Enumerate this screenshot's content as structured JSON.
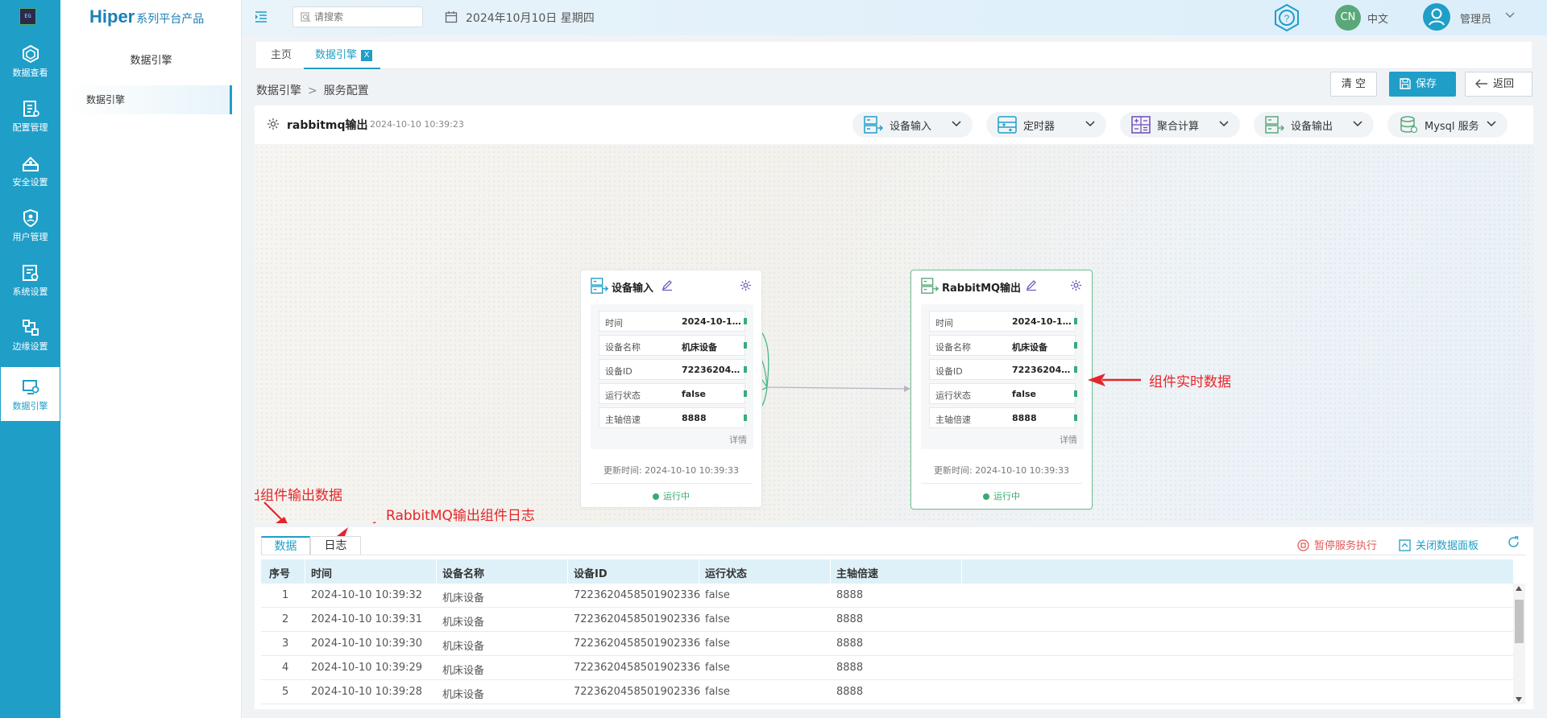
{
  "sidebar": {
    "items": [
      {
        "label": "数据查看",
        "icon": "data-view-icon"
      },
      {
        "label": "配置管理",
        "icon": "config-icon"
      },
      {
        "label": "安全设置",
        "icon": "security-icon"
      },
      {
        "label": "用户管理",
        "icon": "user-manage-icon"
      },
      {
        "label": "系统设置",
        "icon": "system-settings-icon"
      },
      {
        "label": "边缘设置",
        "icon": "edge-settings-icon"
      },
      {
        "label": "数据引擎",
        "icon": "data-engine-icon",
        "active": true
      }
    ],
    "logo_text": "EG"
  },
  "brand": {
    "name": "Hiper",
    "tagline": "系列平台产品"
  },
  "submenu": {
    "title": "数据引擎",
    "items": [
      "数据引擎"
    ]
  },
  "topbar": {
    "search_placeholder": "请搜索",
    "date": "2024年10月10日 星期四",
    "lang_badge": "CN",
    "lang": "中文",
    "user": "管理员"
  },
  "tabs": [
    {
      "label": "主页"
    },
    {
      "label": "数据引擎",
      "active": true,
      "close": "X"
    }
  ],
  "breadcrumb": [
    "数据引擎",
    "服务配置"
  ],
  "breadcrumb_sep": ">",
  "actions": {
    "clear": "清 空",
    "save": "保存",
    "back": "返回"
  },
  "service": {
    "name": "rabbitmq输出",
    "time": "2024-10-10 10:39:23"
  },
  "tools": [
    {
      "label": "设备输入",
      "icon": "device-input-icon"
    },
    {
      "label": "定时器",
      "icon": "timer-icon"
    },
    {
      "label": "聚合计算",
      "icon": "aggregate-icon"
    },
    {
      "label": "设备输出",
      "icon": "device-output-icon"
    },
    {
      "label": "Mysql 服务",
      "icon": "database-icon"
    }
  ],
  "nodes": [
    {
      "title": "设备输入",
      "fields": [
        {
          "key": "时间",
          "value": "2024-10-10..."
        },
        {
          "key": "设备名称",
          "value": "机床设备"
        },
        {
          "key": "设备ID",
          "value": "72236204585..."
        },
        {
          "key": "运行状态",
          "value": "false"
        },
        {
          "key": "主轴倍速",
          "value": "8888"
        }
      ],
      "detail": "详情",
      "update_time": "更新时间: 2024-10-10 10:39:33",
      "status": "运行中"
    },
    {
      "title": "RabbitMQ输出",
      "fields": [
        {
          "key": "时间",
          "value": "2024-10-10..."
        },
        {
          "key": "设备名称",
          "value": "机床设备"
        },
        {
          "key": "设备ID",
          "value": "72236204585..."
        },
        {
          "key": "运行状态",
          "value": "false"
        },
        {
          "key": "主轴倍速",
          "value": "8888"
        }
      ],
      "detail": "详情",
      "update_time": "更新时间: 2024-10-10 10:39:33",
      "status": "运行中"
    }
  ],
  "annotations": {
    "realtime": "组件实时数据",
    "output_data": "出组件输出数据",
    "log": "RabbitMQ输出组件日志"
  },
  "panel": {
    "tabs": [
      "数据",
      "日志"
    ],
    "pause": "暂停服务执行",
    "close_panel": "关闭数据面板"
  },
  "table": {
    "headers": [
      "序号",
      "时间",
      "设备名称",
      "设备ID",
      "运行状态",
      "主轴倍速"
    ],
    "rows": [
      [
        "1",
        "2024-10-10 10:39:32",
        "机床设备",
        "7223620458501902336",
        "false",
        "8888"
      ],
      [
        "2",
        "2024-10-10 10:39:31",
        "机床设备",
        "7223620458501902336",
        "false",
        "8888"
      ],
      [
        "3",
        "2024-10-10 10:39:30",
        "机床设备",
        "7223620458501902336",
        "false",
        "8888"
      ],
      [
        "4",
        "2024-10-10 10:39:29",
        "机床设备",
        "7223620458501902336",
        "false",
        "8888"
      ],
      [
        "5",
        "2024-10-10 10:39:28",
        "机床设备",
        "7223620458501902336",
        "false",
        "8888"
      ]
    ]
  },
  "colors": {
    "primary": "#1f9ec8",
    "success": "#3aaa70",
    "annotation": "#e5252a",
    "danger": "#e05a5a"
  }
}
